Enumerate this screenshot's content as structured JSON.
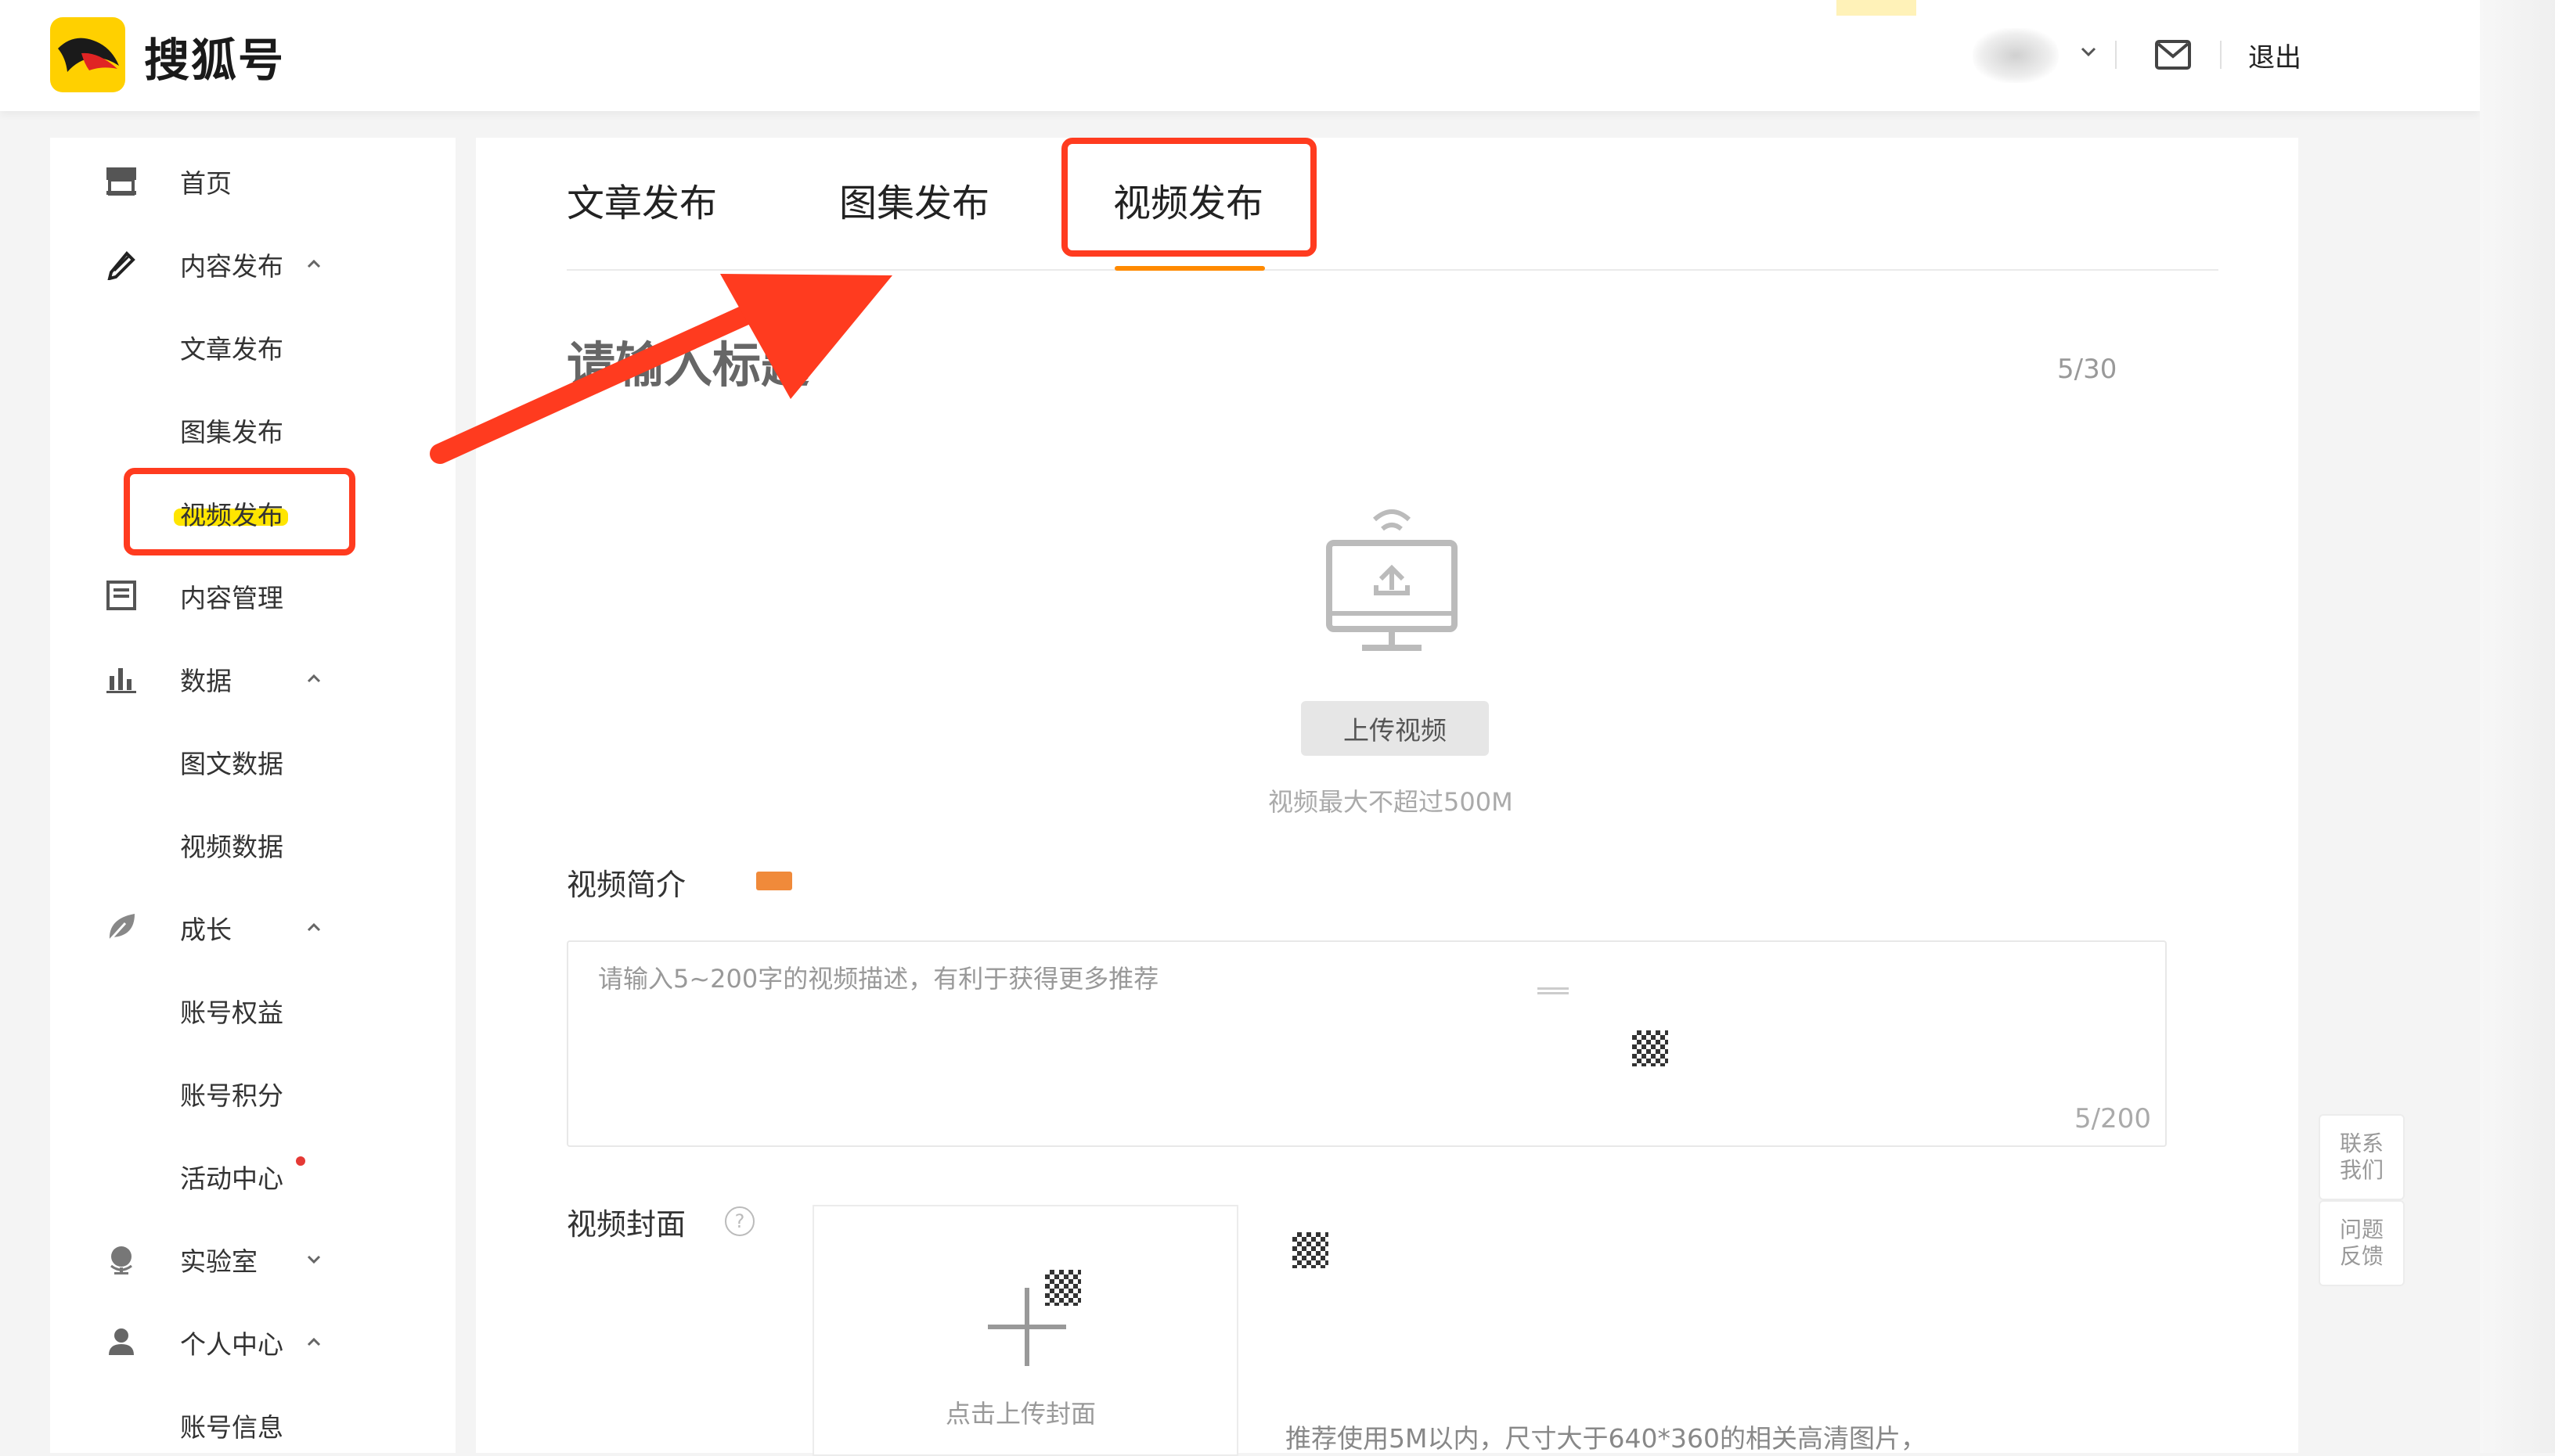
{
  "brand": {
    "name": "搜狐号"
  },
  "header": {
    "logout_label": "退出"
  },
  "sidebar": {
    "items": [
      {
        "label": "首页",
        "icon": "storefront-icon"
      },
      {
        "label": "内容发布",
        "icon": "pen-icon",
        "expanded": true
      },
      {
        "label": "文章发布"
      },
      {
        "label": "图集发布"
      },
      {
        "label": "视频发布",
        "active": true
      },
      {
        "label": "内容管理",
        "icon": "document-icon"
      },
      {
        "label": "数据",
        "icon": "bar-chart-icon",
        "expanded": true
      },
      {
        "label": "图文数据"
      },
      {
        "label": "视频数据"
      },
      {
        "label": "成长",
        "icon": "leaf-icon",
        "expanded": true
      },
      {
        "label": "账号权益"
      },
      {
        "label": "账号积分"
      },
      {
        "label": "活动中心",
        "has_notification": true
      },
      {
        "label": "实验室",
        "icon": "globe-icon",
        "expanded": false
      },
      {
        "label": "个人中心",
        "icon": "user-icon",
        "expanded": true
      },
      {
        "label": "账号信息"
      }
    ]
  },
  "tabs": [
    {
      "label": "文章发布"
    },
    {
      "label": "图集发布"
    },
    {
      "label": "视频发布",
      "active": true
    }
  ],
  "form": {
    "title_placeholder": "请输入标题",
    "title_count": "5/30",
    "upload_button": "上传视频",
    "upload_hint": "视频最大不超过500M",
    "description_label": "视频简介",
    "description_placeholder": "请输入5~200字的视频描述，有利于获得更多推荐",
    "description_count": "5/200",
    "cover_label": "视频封面",
    "cover_help": "?",
    "cover_upload_label": "点击上传封面",
    "cover_hint": "推荐使用5M以内，尺寸大于640*360的相关高清图片，"
  },
  "floating": {
    "contact": "联系我们",
    "feedback": "问题反馈"
  },
  "colors": {
    "accent": "#ff8a00",
    "brand_yellow": "#ffd000",
    "annotation_red": "#ff3b1f",
    "highlight_yellow": "#ffe500"
  }
}
